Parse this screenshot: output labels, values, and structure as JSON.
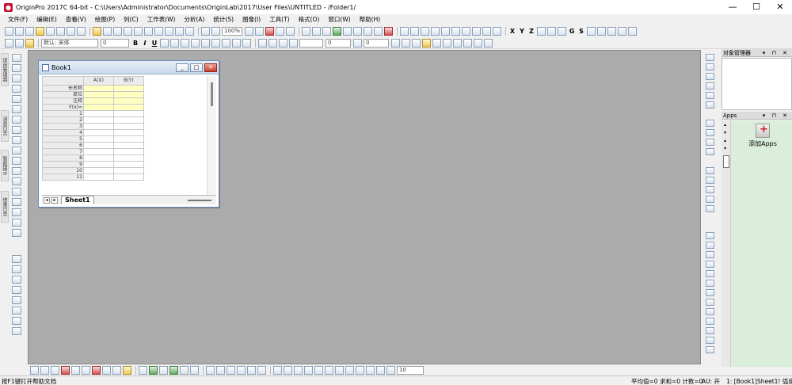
{
  "window": {
    "title": "OriginPro 2017C 64-bit - C:\\Users\\Administrator\\Documents\\OriginLab\\2017\\User Files\\UNTITLED - /Folder1/",
    "minimize": "—",
    "maximize": "☐",
    "close": "✕"
  },
  "menu": [
    "文件(F)",
    "编辑(E)",
    "查看(V)",
    "绘图(P)",
    "列(C)",
    "工作表(W)",
    "分析(A)",
    "统计(S)",
    "图像(I)",
    "工具(T)",
    "格式(O)",
    "窗口(W)",
    "帮助(H)"
  ],
  "toolbar": {
    "zoom": "100%",
    "font": "默认: 宋体",
    "font_size": "0",
    "line_width": "0",
    "bold": "B",
    "italic": "I",
    "underline": "U"
  },
  "book": {
    "title": "Book1",
    "columns": [
      "A(X)",
      "B(Y)"
    ],
    "meta_rows": [
      "长名称",
      "单位",
      "注释",
      "F(x)="
    ],
    "rows": [
      "1",
      "2",
      "3",
      "4",
      "5",
      "6",
      "7",
      "8",
      "9",
      "10",
      "11"
    ],
    "sheet_tab": "Sheet1"
  },
  "panels": {
    "object_manager": "对象管理器",
    "apps": "Apps",
    "add_apps": "添加Apps",
    "panel_buttons": "▾ ⊓ ✕"
  },
  "bottom_toolbar": {
    "size_value": "10"
  },
  "status": {
    "hint": "按F1键打开帮助文档",
    "stats": "平均值=0 求和=0 计数=0",
    "au": "AU: 开",
    "location": "1: [Book1]Sheet1! 弧度"
  },
  "colors": {
    "workspace": "#ababab",
    "meta_rows": "#ffffc0",
    "apps_panel": "#dbeedb",
    "title_accent": "#c8102e"
  }
}
